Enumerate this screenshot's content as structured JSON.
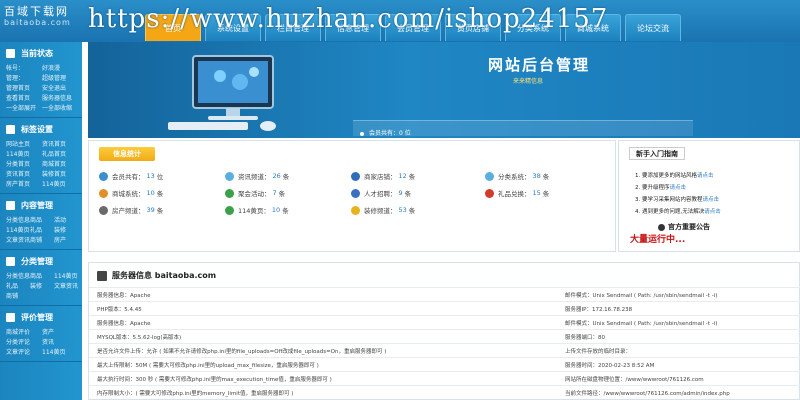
{
  "watermark": "https://www.huzhan.com/ishop24157",
  "brand": {
    "title": "百域下载网",
    "sub": "baitaoba.com"
  },
  "nav": {
    "tabs": [
      {
        "label": "首页",
        "active": true
      },
      {
        "label": "系统设置",
        "active": false
      },
      {
        "label": "栏目管理",
        "active": false
      },
      {
        "label": "信息管理",
        "active": false
      },
      {
        "label": "会员管理",
        "active": false
      },
      {
        "label": "黄页店铺",
        "active": false
      },
      {
        "label": "分类系统",
        "active": false
      },
      {
        "label": "商城系统",
        "active": false
      },
      {
        "label": "论坛交流",
        "active": false
      }
    ]
  },
  "sidebar": {
    "sections": [
      {
        "title": "当前状态",
        "cols": 2,
        "links": [
          "帐号：",
          "好浪漫",
          "管理：",
          "超级管理",
          "管理首页",
          "安全退出",
          "查看首页",
          "服务器信息",
          "一全部展开",
          "一全部收缩"
        ]
      },
      {
        "title": "标签设置",
        "cols": 2,
        "links": [
          "网站主页",
          "资讯首页",
          "114黄页",
          "礼品首页",
          "分类首页",
          "商城首页",
          "资讯首页",
          "装修首页",
          "房产首页",
          "114黄页"
        ]
      },
      {
        "title": "内容管理",
        "cols": 3,
        "links": [
          "分类信息",
          "商品",
          "活动",
          "114黄页",
          "礼品",
          "装修",
          "文章资讯",
          "商铺",
          "房产"
        ]
      },
      {
        "title": "分类管理",
        "cols": 3,
        "links": [
          "分类信息",
          "商品",
          "114黄页",
          "礼品",
          "装修",
          "文章资讯",
          "商铺"
        ]
      },
      {
        "title": "评价管理",
        "cols": 2,
        "links": [
          "商城评价",
          "资产",
          "分类评论",
          "资讯",
          "文章评论",
          "114黄页"
        ]
      }
    ]
  },
  "banner": {
    "title": "网站后台管理",
    "subtitle": "来来精信息",
    "member_text": "会员共有：0 位"
  },
  "stats": {
    "badge": "信息统计",
    "items": [
      {
        "label": "会员共有：",
        "value": "13",
        "unit": "位",
        "color": "#3b8fd1"
      },
      {
        "label": "资讯频道：",
        "value": "26",
        "unit": "条",
        "color": "#5aaee0"
      },
      {
        "label": "商家店铺：",
        "value": "12",
        "unit": "条",
        "color": "#2f6fb8"
      },
      {
        "label": "分类系统：",
        "value": "38",
        "unit": "条",
        "color": "#5aaee0"
      },
      {
        "label": "商城系统：",
        "value": "10",
        "unit": "条",
        "color": "#e0902a"
      },
      {
        "label": "聚会活动：",
        "value": "7",
        "unit": "条",
        "color": "#3aa04a"
      },
      {
        "label": "人才招聘：",
        "value": "9",
        "unit": "条",
        "color": "#3b6fc0"
      },
      {
        "label": "礼品兑换：",
        "value": "15",
        "unit": "条",
        "color": "#d23a2a"
      },
      {
        "label": "房产频道：",
        "value": "39",
        "unit": "条",
        "color": "#6a6a6a"
      },
      {
        "label": "114黄页：",
        "value": "10",
        "unit": "条",
        "color": "#3aa04a"
      },
      {
        "label": "装修频道：",
        "value": "53",
        "unit": "条",
        "color": "#e8b21a"
      }
    ]
  },
  "newbie": {
    "header": "新手入门指南",
    "items": [
      {
        "text": "1. 要添加更多的网站风格",
        "link": "请点击"
      },
      {
        "text": "2. 要升级程序",
        "link": "请点击"
      },
      {
        "text": "3. 要学习采集网站内容教程",
        "link": "请点击"
      },
      {
        "text": "4. 遇到更多的问题,无法解决",
        "link": "请点击"
      }
    ],
    "notice_title": "官方重要公告",
    "red_text": "大量运行中..."
  },
  "server": {
    "title": "服务器信息 baitaoba.com",
    "rows": [
      {
        "left": "服务器信息：Apache",
        "right": "邮件模式：Unix Sendmail ( Path: /usr/sbin/sendmail -t -i)"
      },
      {
        "left": "PHP版本：5.4.45",
        "right": "服务器IP：172.16.78.238"
      },
      {
        "left": "服务器信息：Apache",
        "right": "邮件模式：Unix Sendmail ( Path: /usr/sbin/sendmail -t -i)"
      },
      {
        "left": "MYSQL版本：5.5.62-log(高版本)",
        "right": "服务器端口：80"
      },
      {
        "left": "是否允许文件上传：允许 ( 如果不允许请修改php.ini里的file_uploads=Off改成file_uploads=On，重启服务器即可 )",
        "right": "上传文件存放的临时目录："
      },
      {
        "left": "最大上传限制：50M ( 需要大可修改php.ini里的upload_max_filesize，重启服务器即可 )",
        "right": "服务器时间：2020-02-23 8:52 AM"
      },
      {
        "left": "最大执行时间：300 秒 ( 需要大可修改php.ini里的max_execution_time值，重启服务器即可 )",
        "right": "网站所在磁盘物理位置：/www/wwwroot/761126.com"
      },
      {
        "left": "内存限制大小：( 需要大可修改php.ini里的memory_limit值，重启服务器即可 )",
        "right": "当前文件路径：/www/wwwroot/761126.com/admin/index.php"
      }
    ]
  },
  "colors": {
    "header_blue": "#1f80c0",
    "active_tab": "#f5a614",
    "badge_yellow": "#f7b928",
    "link_blue": "#2b7bc0",
    "notice_red": "#c81414"
  }
}
